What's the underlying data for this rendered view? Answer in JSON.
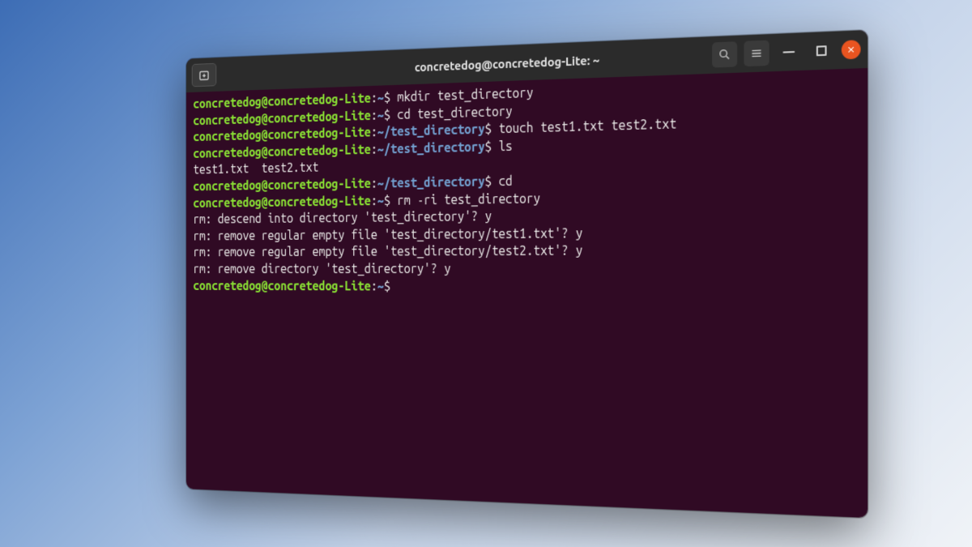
{
  "window": {
    "title": "concretedog@concretedog-Lite: ~"
  },
  "colors": {
    "background": "#300a24",
    "prompt_user": "#8ae234",
    "prompt_path": "#729fcf",
    "text": "#eeeeec",
    "close": "#e95420"
  },
  "prompt": {
    "user_host": "concretedog@concretedog-Lite",
    "home_path": "~",
    "test_path": "~/test_directory",
    "sigil": "$"
  },
  "lines": [
    {
      "type": "prompt",
      "path": "home",
      "command": "mkdir test_directory"
    },
    {
      "type": "prompt",
      "path": "home",
      "command": "cd test_directory"
    },
    {
      "type": "prompt",
      "path": "test",
      "command": "touch test1.txt test2.txt"
    },
    {
      "type": "prompt",
      "path": "test",
      "command": "ls"
    },
    {
      "type": "output",
      "text": "test1.txt  test2.txt"
    },
    {
      "type": "prompt",
      "path": "test",
      "command": "cd"
    },
    {
      "type": "prompt",
      "path": "home",
      "command": "rm -ri test_directory"
    },
    {
      "type": "output",
      "text": "rm: descend into directory 'test_directory'? y"
    },
    {
      "type": "output",
      "text": "rm: remove regular empty file 'test_directory/test1.txt'? y"
    },
    {
      "type": "output",
      "text": "rm: remove regular empty file 'test_directory/test2.txt'? y"
    },
    {
      "type": "output",
      "text": "rm: remove directory 'test_directory'? y"
    },
    {
      "type": "prompt",
      "path": "home",
      "command": ""
    }
  ],
  "icons": {
    "new_tab": "new-tab-icon",
    "search": "search-icon",
    "menu": "hamburger-icon",
    "minimize": "minimize-icon",
    "maximize": "maximize-icon",
    "close": "close-icon"
  }
}
